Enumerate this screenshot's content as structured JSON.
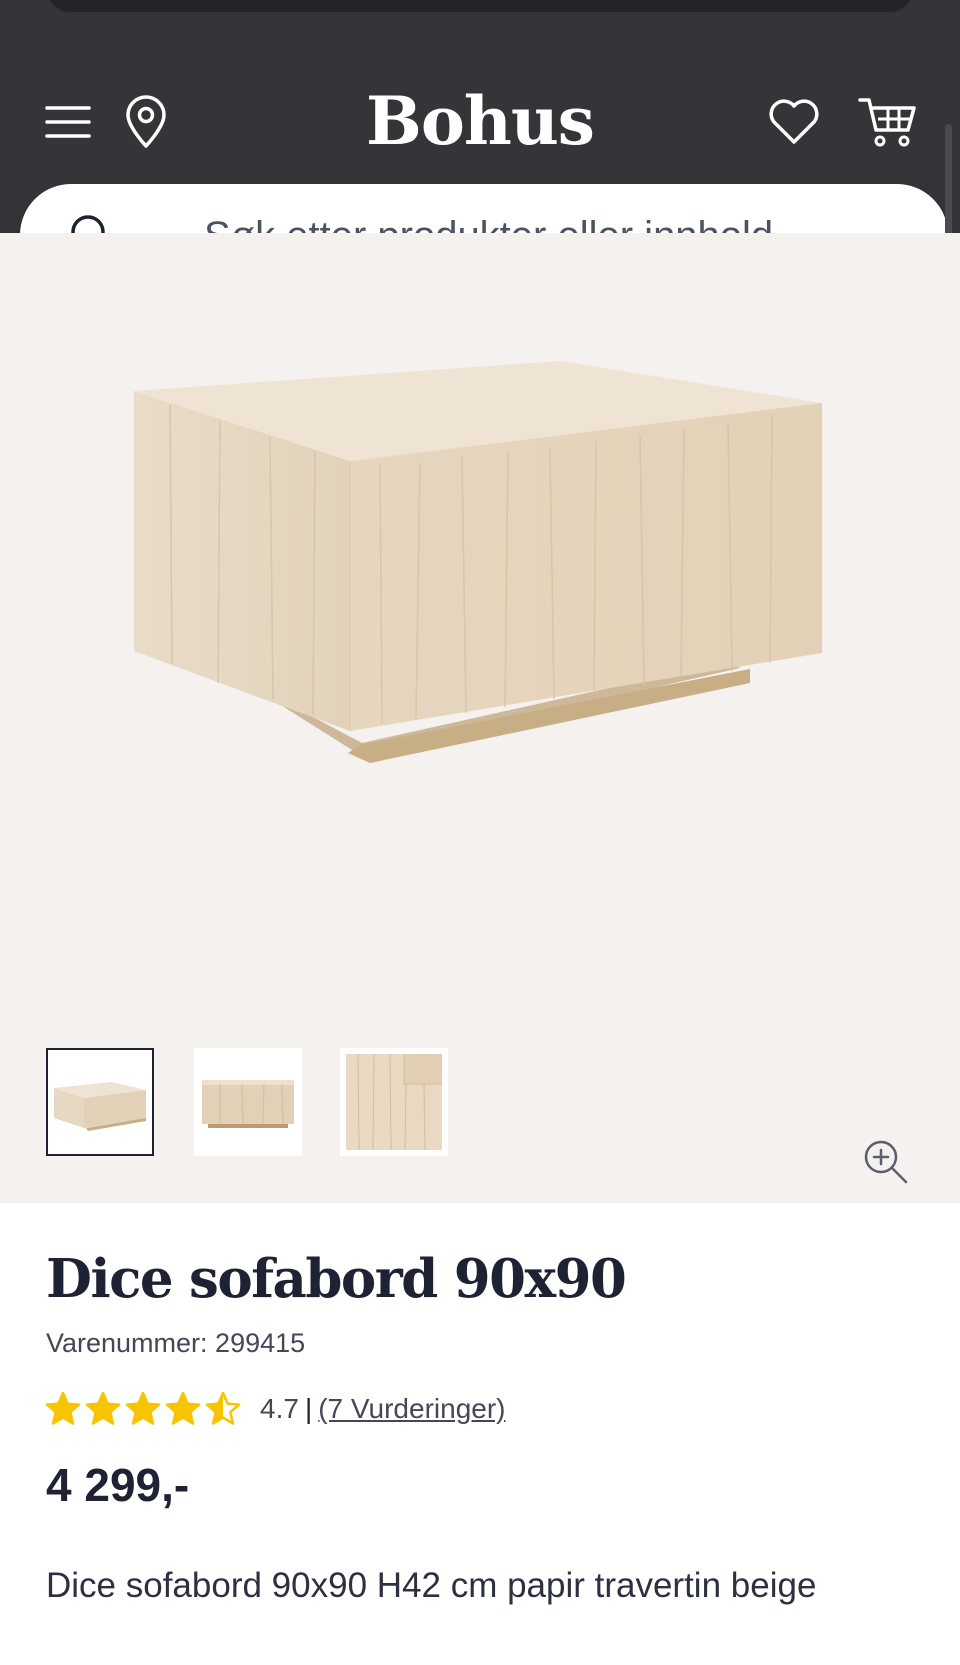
{
  "header": {
    "logo": "Bohus",
    "icons": [
      "menu-icon",
      "location-icon",
      "heart-icon",
      "cart-icon"
    ]
  },
  "search": {
    "placeholder": "Søk etter produkter eller innhold ..."
  },
  "gallery": {
    "thumbnails_count": 3,
    "active_thumbnail": 1,
    "zoom_icon": "zoom-in-icon"
  },
  "product": {
    "title": "Dice sofabord 90x90",
    "sku_text": "Varenummer: 299415",
    "rating": {
      "value": 4.7,
      "value_text": "4.7",
      "separator": "|",
      "reviews_text": "(7 Vurderinger)",
      "max_stars": 5
    },
    "price": "4 299,-",
    "description": "Dice sofabord 90x90 H42 cm papir travertin beige"
  },
  "colors": {
    "header_bg": "#353539",
    "gallery_bg": "#f4f1ef",
    "star": "#f6c500",
    "text_dark": "#1f2233"
  }
}
